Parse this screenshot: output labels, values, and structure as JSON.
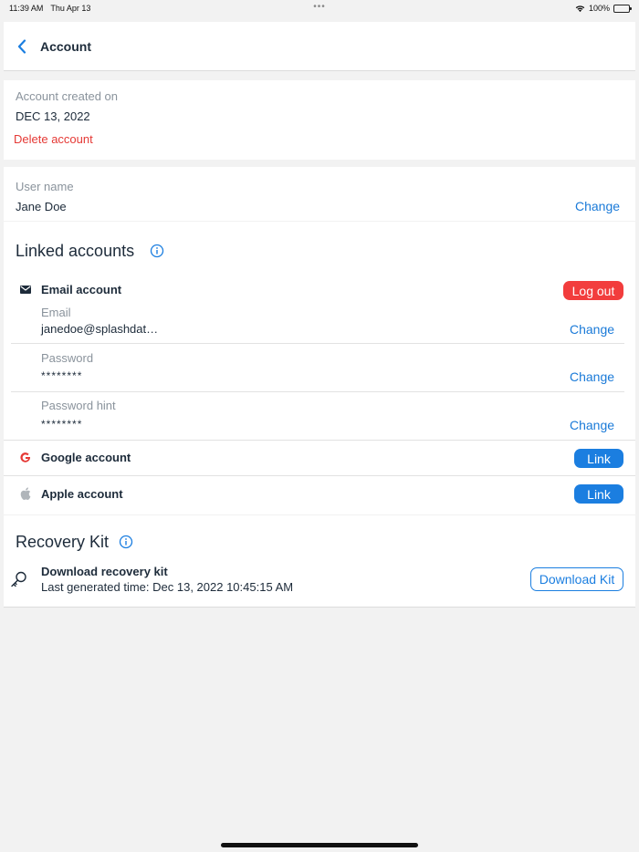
{
  "status_bar": {
    "time": "11:39 AM",
    "date": "Thu Apr 13",
    "battery": "100%"
  },
  "nav": {
    "title": "Account"
  },
  "account_info": {
    "created_label": "Account created on",
    "created_value": "DEC 13, 2022",
    "delete_label": "Delete account"
  },
  "user": {
    "label": "User name",
    "value": "Jane Doe",
    "change_label": "Change"
  },
  "linked": {
    "title": "Linked accounts",
    "email_account": {
      "title": "Email account",
      "logout_label": "Log out",
      "email_label": "Email",
      "email_value": "janedoe@splashdat…",
      "password_label": "Password",
      "password_value": "********",
      "hint_label": "Password hint",
      "hint_value": "********",
      "change_label": "Change"
    },
    "google": {
      "title": "Google account",
      "link_label": "Link"
    },
    "apple": {
      "title": "Apple account",
      "link_label": "Link"
    }
  },
  "recovery": {
    "title": "Recovery Kit",
    "item_title": "Download recovery kit",
    "item_subtitle": "Last generated time: Dec 13, 2022 10:45:15 AM",
    "download_label": "Download Kit"
  },
  "colors": {
    "accent": "#1b7ee0",
    "danger": "#f23d3d",
    "text": "#1d2b3a",
    "muted": "#8a939c"
  }
}
